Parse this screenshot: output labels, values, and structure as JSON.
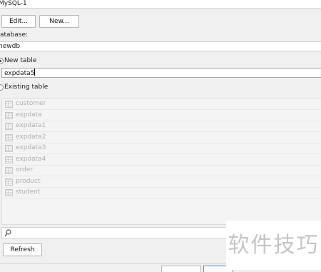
{
  "connection": {
    "name": "MySQL-1"
  },
  "toolbar": {
    "edit_label": "Edit...",
    "new_label": "New..."
  },
  "database": {
    "label": "atabase:",
    "value": "newdb"
  },
  "target": {
    "new_table_label": "New table",
    "new_table_value": "expdata5",
    "existing_table_label": "Existing table"
  },
  "tables": [
    "customer",
    "expdata",
    "expdata1",
    "expdata2",
    "expdata3",
    "expdata4",
    "order",
    "product",
    "student"
  ],
  "search": {
    "placeholder": ""
  },
  "refresh": {
    "label": "Refresh"
  },
  "watermark": {
    "text": "软件技巧"
  },
  "icons": {
    "table": "table-icon",
    "search": "search-icon"
  }
}
